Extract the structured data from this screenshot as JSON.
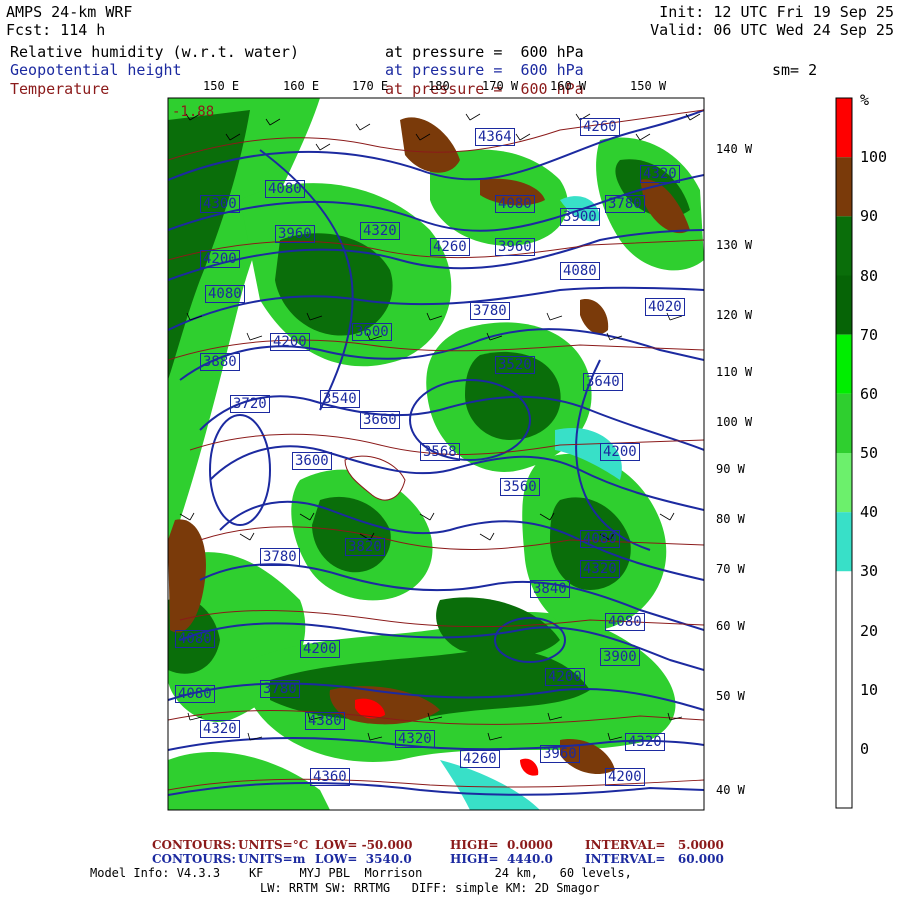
{
  "header": {
    "model": "AMPS 24-km WRF",
    "fcst": "Fcst: 114 h",
    "init": "Init: 12 UTC Fri 19 Sep 25",
    "valid": "Valid: 06 UTC Wed 24 Sep 25",
    "fields": [
      {
        "name": "Relative humidity (w.r.t. water)",
        "level": "at pressure =  600 hPa",
        "color": "#000000"
      },
      {
        "name": "Geopotential height",
        "level": "at pressure =  600 hPa",
        "color": "#1c2aa0"
      },
      {
        "name": "Temperature",
        "level": "at pressure =  600 hPa",
        "color": "#8b1a1a"
      }
    ],
    "smoothing": "sm= 2"
  },
  "lon_top": [
    "150 E",
    "160 E",
    "170 E",
    "180",
    "170 W",
    "160 W",
    "150 W"
  ],
  "lon_right": [
    "140 W",
    "130 W",
    "120 W",
    "110 W",
    "100 W",
    "90 W",
    "80 W",
    "70 W",
    "60 W",
    "50 W",
    "40 W"
  ],
  "colorbar": {
    "unit": "%",
    "labels": [
      "100",
      "90",
      "80",
      "70",
      "60",
      "50",
      "40",
      "30",
      "20",
      "10",
      "0"
    ],
    "colors": [
      "#ff0000",
      "#7a3a0a",
      "#0a6e0a",
      "#066406",
      "#00ee00",
      "#2fcf2f",
      "#6cf06c",
      "#38e0c8",
      "#ffffff",
      "#ffffff",
      "#ffffff",
      "#ffffff"
    ]
  },
  "height_labels": [
    "4364",
    "4260",
    "4320",
    "4300",
    "4080",
    "3960",
    "4200",
    "4080",
    "4320",
    "4260",
    "4080",
    "3900",
    "3780",
    "3960",
    "4080",
    "4020",
    "4200",
    "3600",
    "3780",
    "3520",
    "3640",
    "3880",
    "3540",
    "3568",
    "4200",
    "3600",
    "3660",
    "3720",
    "3820",
    "3780",
    "3560",
    "4080",
    "4320",
    "3840",
    "4080",
    "4200",
    "3900",
    "4200",
    "3780",
    "4080",
    "4320",
    "4380",
    "4260",
    "3960",
    "4320",
    "4080",
    "4320",
    "4200",
    "4360"
  ],
  "temp_labels": [
    "-1.88"
  ],
  "footer": {
    "line1": {
      "contours": "CONTOURS:",
      "units": "UNITS=°C",
      "low": "LOW= -50.000",
      "high": "HIGH=  0.0000",
      "interval": "INTERVAL=   5.0000"
    },
    "line2": {
      "contours": "CONTOURS:",
      "units": "UNITS=m",
      "low": "LOW=  3540.0",
      "high": "HIGH=  4440.0",
      "interval": "INTERVAL=   60.000"
    },
    "line3": "Model Info: V4.3.3    KF     MYJ PBL  Morrison          24 km,   60 levels,",
    "line4": "LW: RRTM SW: RRTMG   DIFF: simple KM: 2D Smagor"
  }
}
